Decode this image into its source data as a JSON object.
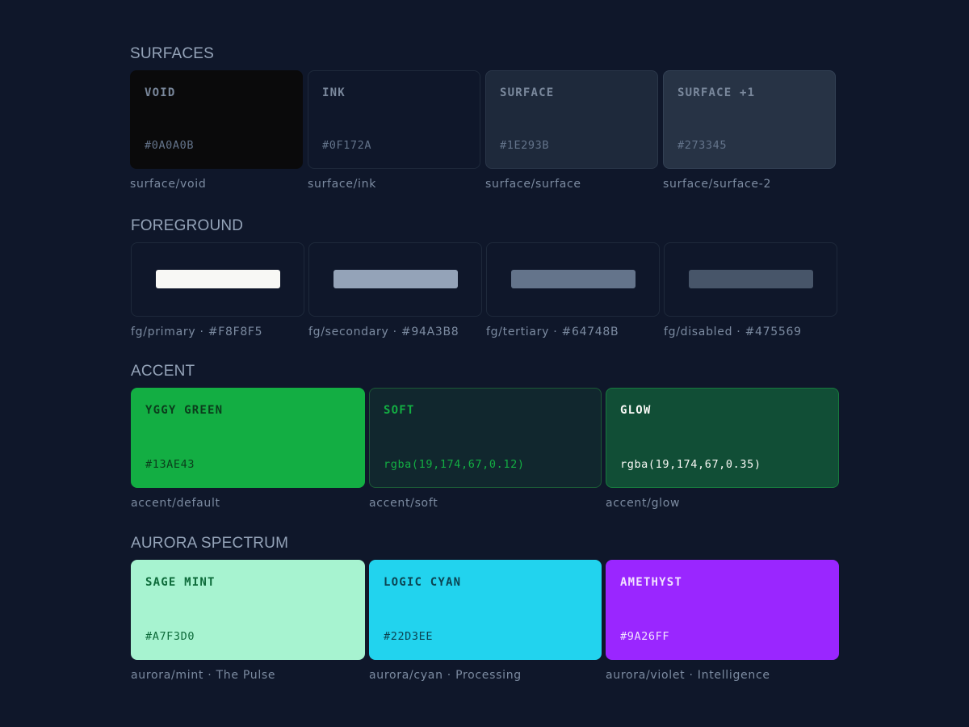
{
  "surfaces": {
    "title": "SURFACES",
    "items": [
      {
        "name": "VOID",
        "hex": "#0A0A0B",
        "token": "surface/void",
        "color": "#0A0A0B",
        "border": "#0A0A0B"
      },
      {
        "name": "INK",
        "hex": "#0F172A",
        "token": "surface/ink",
        "color": "#0F172A",
        "border": "#1E293B"
      },
      {
        "name": "SURFACE",
        "hex": "#1E293B",
        "token": "surface/surface",
        "color": "#1E293B",
        "border": "#2A3649"
      },
      {
        "name": "SURFACE +1",
        "hex": "#273345",
        "token": "surface/surface-2",
        "color": "#273345",
        "border": "#334155"
      }
    ]
  },
  "foreground": {
    "title": "FOREGROUND",
    "items": [
      {
        "token": "fg/primary · #F8F8F5",
        "color": "#F8F8F5"
      },
      {
        "token": "fg/secondary · #94A3B8",
        "color": "#94A3B8"
      },
      {
        "token": "fg/tertiary · #64748B",
        "color": "#64748B"
      },
      {
        "token": "fg/disabled · #475569",
        "color": "#475569"
      }
    ]
  },
  "accent": {
    "title": "ACCENT",
    "items": [
      {
        "name": "YGGY GREEN",
        "hex": "#13AE43",
        "token": "accent/default",
        "color": "#13AE43",
        "border": "#13AE43",
        "text_color": "#0B3D1C"
      },
      {
        "name": "SOFT",
        "hex": "rgba(19,174,67,0.12)",
        "token": "accent/soft",
        "color": "#11272E",
        "border": "#1B5A36",
        "text_color": "#13AE43"
      },
      {
        "name": "GLOW",
        "hex": "rgba(19,174,67,0.35)",
        "token": "accent/glow",
        "color": "#114E36",
        "border": "#177A3D",
        "text_color": "#F8F8F5"
      }
    ]
  },
  "aurora": {
    "title": "AURORA SPECTRUM",
    "items": [
      {
        "name": "SAGE MINT",
        "hex": "#A7F3D0",
        "token": "aurora/mint · The Pulse",
        "color": "#A7F3D0",
        "border": "#A7F3D0",
        "text_color": "#0D6B3A"
      },
      {
        "name": "LOGIC CYAN",
        "hex": "#22D3EE",
        "token": "aurora/cyan · Processing",
        "color": "#22D3EE",
        "border": "#22D3EE",
        "text_color": "#0B4452"
      },
      {
        "name": "AMETHYST",
        "hex": "#9A26FF",
        "token": "aurora/violet · Intelligence",
        "color": "#9A26FF",
        "border": "#9A26FF",
        "text_color": "#F1E2FF"
      }
    ]
  }
}
